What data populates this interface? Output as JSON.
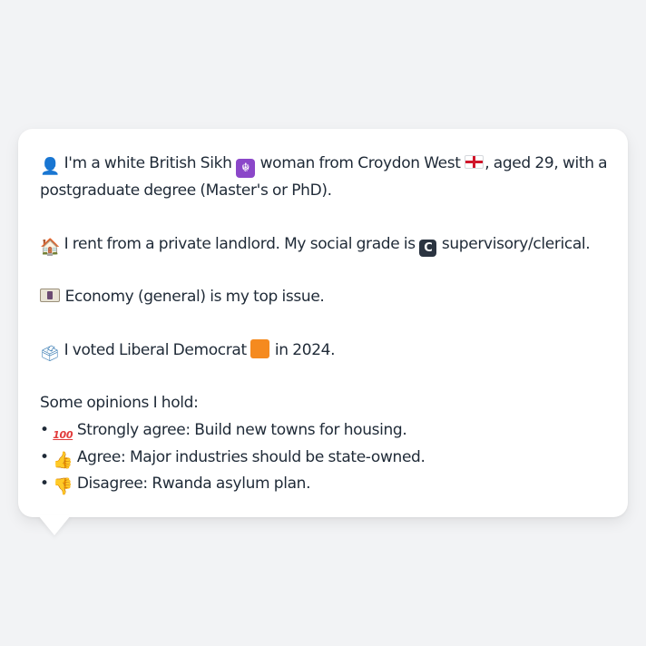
{
  "intro": {
    "person_icon": "bust-in-silhouette",
    "lead": "I'm a white British Sikh",
    "religion_icon": "khanda",
    "middle": "woman from Croydon West",
    "flag_icon": "england-flag",
    "tail": ", aged 29, with a postgraduate degree (Master's or PhD)."
  },
  "housing": {
    "icon": "house",
    "lead": "I rent from a private landlord. My social grade is",
    "grade_badge": "C",
    "tail": "supervisory/clerical."
  },
  "issue": {
    "icon": "banknote",
    "text": "Economy (general) is my top issue."
  },
  "vote": {
    "icon": "ballot-box",
    "lead": "I voted Liberal Democrat",
    "party_color": "#f58a1f",
    "tail": "in 2024."
  },
  "opinions": {
    "heading": "Some opinions I hold:",
    "bullet": "•",
    "items": [
      {
        "icon": "hundred-points",
        "text": "Strongly agree: Build new towns for housing."
      },
      {
        "icon": "thumbs-up",
        "text": "Agree: Major industries should be state-owned."
      },
      {
        "icon": "thumbs-down",
        "text": "Disagree: Rwanda asylum plan."
      }
    ]
  }
}
